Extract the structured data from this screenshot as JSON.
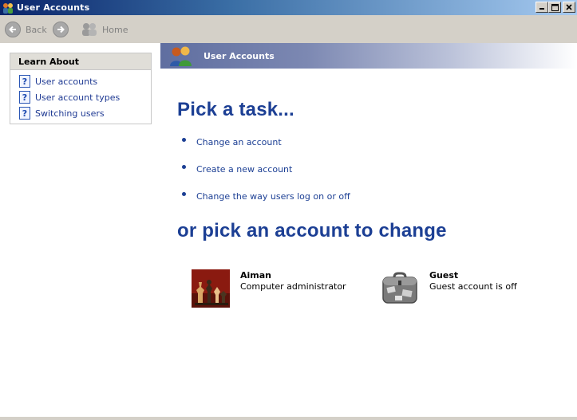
{
  "window": {
    "title": "User Accounts",
    "controls": [
      "minimize-icon",
      "maximize-icon",
      "close-icon"
    ]
  },
  "toolbar": {
    "back_label": "Back",
    "home_label": "Home"
  },
  "learn_about": {
    "heading": "Learn About",
    "items": [
      {
        "label": "User accounts",
        "icon": "help-icon"
      },
      {
        "label": "User account types",
        "icon": "help-icon"
      },
      {
        "label": "Switching users",
        "icon": "help-icon"
      }
    ]
  },
  "header": {
    "title": "User Accounts"
  },
  "main": {
    "task_heading": "Pick a task...",
    "tasks": [
      {
        "label": "Change an account"
      },
      {
        "label": "Create a new account"
      },
      {
        "label": "Change the way users log on or off"
      }
    ],
    "account_heading": "or pick an account to change",
    "accounts": [
      {
        "name": "Aiman",
        "description": "Computer administrator",
        "picture": "chess-pieces"
      },
      {
        "name": "Guest",
        "description": "Guest account is off",
        "picture": "suitcase"
      }
    ]
  },
  "colors": {
    "link": "#1c3f94",
    "titlebar_start": "#0a246a",
    "chrome": "#d4d0c8"
  }
}
